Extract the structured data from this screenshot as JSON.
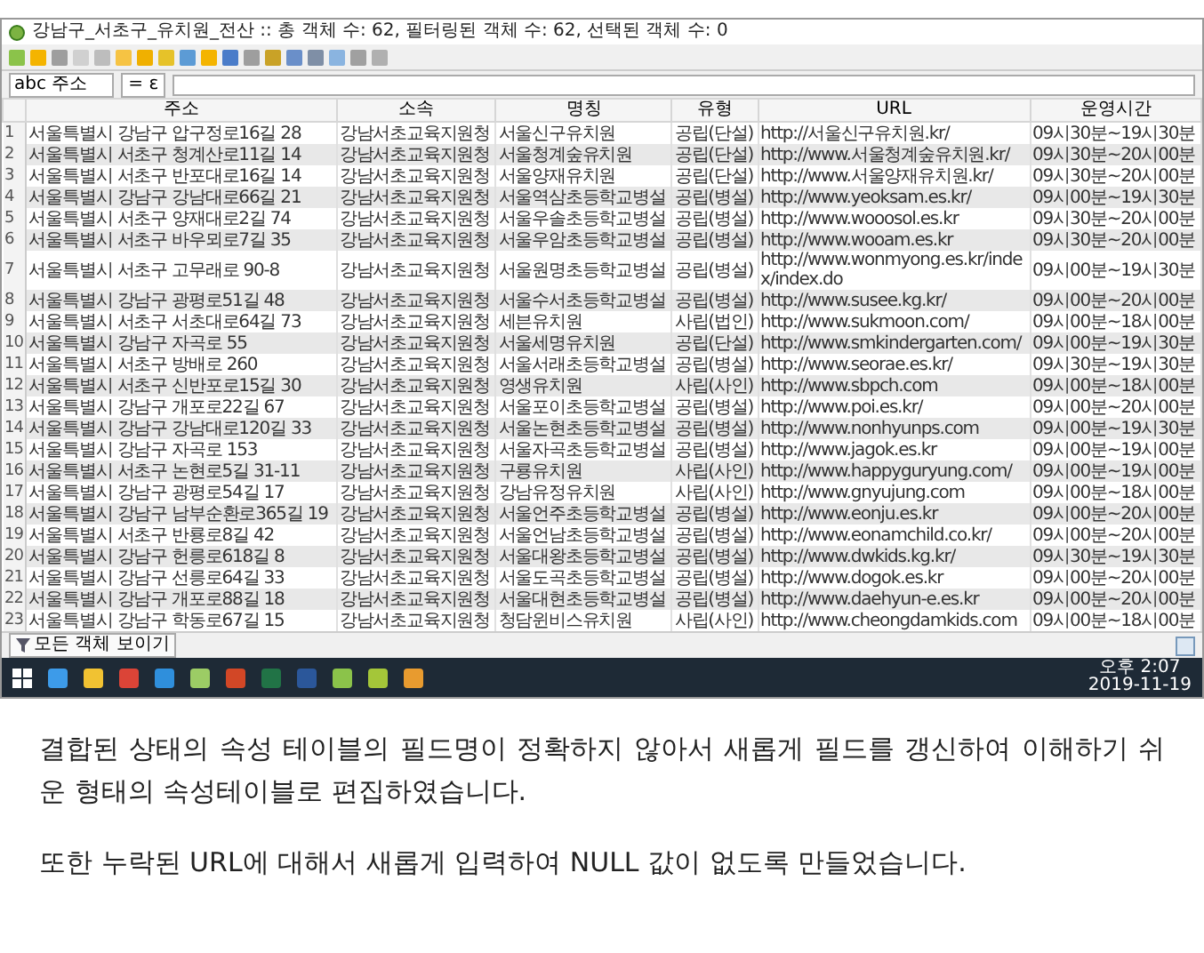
{
  "window": {
    "title": "강남구_서초구_유치원_전산 :: 총 객체 수: 62, 필터링된 객체 수: 62, 선택된 객체 수: 0"
  },
  "filter": {
    "field": "abc 주소",
    "operator": "= ε"
  },
  "table": {
    "columns": [
      "주소",
      "소속",
      "명칭",
      "유형",
      "URL",
      "운영시간"
    ],
    "rows": [
      {
        "number": "1",
        "cells": [
          "서울특별시 강남구 압구정로16길 28",
          "강남서초교육지원청",
          "서울신구유치원",
          "공립(단설)",
          "http://서울신구유치원.kr/",
          "09시30분~19시30분"
        ]
      },
      {
        "number": "2",
        "cells": [
          "서울특별시 서초구 청계산로11길 14",
          "강남서초교육지원청",
          "서울청계숲유치원",
          "공립(단설)",
          "http://www.서울청계숲유치원.kr/",
          "09시30분~20시00분"
        ]
      },
      {
        "number": "3",
        "cells": [
          "서울특별시 서초구 반포대로16길 14",
          "강남서초교육지원청",
          "서울양재유치원",
          "공립(단설)",
          "http://www.서울양재유치원.kr/",
          "09시30분~20시00분"
        ]
      },
      {
        "number": "4",
        "cells": [
          "서울특별시 강남구 강남대로66길 21",
          "강남서초교육지원청",
          "서울역삼초등학교병설",
          "공립(병설)",
          "http://www.yeoksam.es.kr/",
          "09시00분~19시30분"
        ]
      },
      {
        "number": "5",
        "cells": [
          "서울특별시 서초구 양재대로2길 74",
          "강남서초교육지원청",
          "서울우솔초등학교병설",
          "공립(병설)",
          "http://www.wooosol.es.kr",
          "09시30분~20시00분"
        ]
      },
      {
        "number": "6",
        "cells": [
          "서울특별시 서초구 바우뫼로7길 35",
          "강남서초교육지원청",
          "서울우암초등학교병설",
          "공립(병설)",
          "http://www.wooam.es.kr",
          "09시30분~20시00분"
        ]
      },
      {
        "number": "7",
        "cells": [
          "서울특별시 서초구 고무래로 90-8",
          "강남서초교육지원청",
          "서울원명초등학교병설",
          "공립(병설)",
          "http://www.wonmyong.es.kr/index/index.do",
          "09시00분~19시30분"
        ]
      },
      {
        "number": "8",
        "cells": [
          "서울특별시 강남구 광평로51길 48",
          "강남서초교육지원청",
          "서울수서초등학교병설",
          "공립(병설)",
          "http://www.susee.kg.kr/",
          "09시00분~20시00분"
        ]
      },
      {
        "number": "9",
        "cells": [
          "서울특별시 서초구 서초대로64길 73",
          "강남서초교육지원청",
          "세븐유치원",
          "사립(법인)",
          "http://www.sukmoon.com/",
          "09시00분~18시00분"
        ]
      },
      {
        "number": "10",
        "cells": [
          "서울특별시 강남구 자곡로 55",
          "강남서초교육지원청",
          "서울세명유치원",
          "공립(단설)",
          "http://www.smkindergarten.com/",
          "09시00분~19시30분"
        ]
      },
      {
        "number": "11",
        "cells": [
          "서울특별시 서초구 방배로 260",
          "강남서초교육지원청",
          "서울서래초등학교병설",
          "공립(병설)",
          "http://www.seorae.es.kr/",
          "09시30분~19시30분"
        ]
      },
      {
        "number": "12",
        "cells": [
          "서울특별시 서초구 신반포로15길 30",
          "강남서초교육지원청",
          "영생유치원",
          "사립(사인)",
          "http://www.sbpch.com",
          "09시00분~18시00분"
        ]
      },
      {
        "number": "13",
        "cells": [
          "서울특별시 강남구 개포로22길 67",
          "강남서초교육지원청",
          "서울포이초등학교병설",
          "공립(병설)",
          "http://www.poi.es.kr/",
          "09시00분~20시00분"
        ]
      },
      {
        "number": "14",
        "cells": [
          "서울특별시 강남구 강남대로120길 33",
          "강남서초교육지원청",
          "서울논현초등학교병설",
          "공립(병설)",
          "http://www.nonhyunps.com",
          "09시00분~19시30분"
        ]
      },
      {
        "number": "15",
        "cells": [
          "서울특별시 강남구 자곡로 153",
          "강남서초교육지원청",
          "서울자곡초등학교병설",
          "공립(병설)",
          "http://www.jagok.es.kr",
          "09시00분~19시00분"
        ]
      },
      {
        "number": "16",
        "cells": [
          "서울특별시 서초구 논현로5길 31-11",
          "강남서초교육지원청",
          "구룡유치원",
          "사립(사인)",
          "http://www.happyguryung.com/",
          "09시00분~19시00분"
        ]
      },
      {
        "number": "17",
        "cells": [
          "서울특별시 강남구 광평로54길 17",
          "강남서초교육지원청",
          "강남유정유치원",
          "사립(사인)",
          "http://www.gnyujung.com",
          "09시00분~18시00분"
        ]
      },
      {
        "number": "18",
        "cells": [
          "서울특별시 강남구 남부순환로365길 19",
          "강남서초교육지원청",
          "서울언주초등학교병설",
          "공립(병설)",
          "http://www.eonju.es.kr",
          "09시00분~20시00분"
        ]
      },
      {
        "number": "19",
        "cells": [
          "서울특별시 서초구 반룡로8길 42",
          "강남서초교육지원청",
          "서울언남초등학교병설",
          "공립(병설)",
          "http://www.eonamchild.co.kr/",
          "09시00분~20시00분"
        ]
      },
      {
        "number": "20",
        "cells": [
          "서울특별시 강남구 헌릉로618길 8",
          "강남서초교육지원청",
          "서울대왕초등학교병설",
          "공립(병설)",
          "http://www.dwkids.kg.kr/",
          "09시30분~19시30분"
        ]
      },
      {
        "number": "21",
        "cells": [
          "서울특별시 강남구 선릉로64길 33",
          "강남서초교육지원청",
          "서울도곡초등학교병설",
          "공립(병설)",
          "http://www.dogok.es.kr",
          "09시00분~20시00분"
        ]
      },
      {
        "number": "22",
        "cells": [
          "서울특별시 강남구 개포로88길 18",
          "강남서초교육지원청",
          "서울대현초등학교병설",
          "공립(병설)",
          "http://www.daehyun-e.es.kr",
          "09시00분~20시00분"
        ]
      },
      {
        "number": "23",
        "cells": [
          "서울특별시 강남구 학동로67길 15",
          "강남서초교육지원청",
          "청담윈비스유치원",
          "사립(사인)",
          "http://www.cheongdamkids.com",
          "09시00분~18시00분"
        ]
      }
    ]
  },
  "bottom_bar": {
    "filter_button": "모든 객체 보이기"
  },
  "taskbar": {
    "time": "오후 2:07",
    "date": "2019-11-19"
  },
  "paragraphs": [
    "결합된 상태의 속성 테이블의 필드명이 정확하지 않아서 새롭게 필드를 갱신하여 이해하기 쉬운 형태의 속성테이블로 편집하였습니다.",
    "또한 누락된 URL에 대해서 새롭게 입력하여 NULL 값이 없도록 만들었습니다."
  ]
}
